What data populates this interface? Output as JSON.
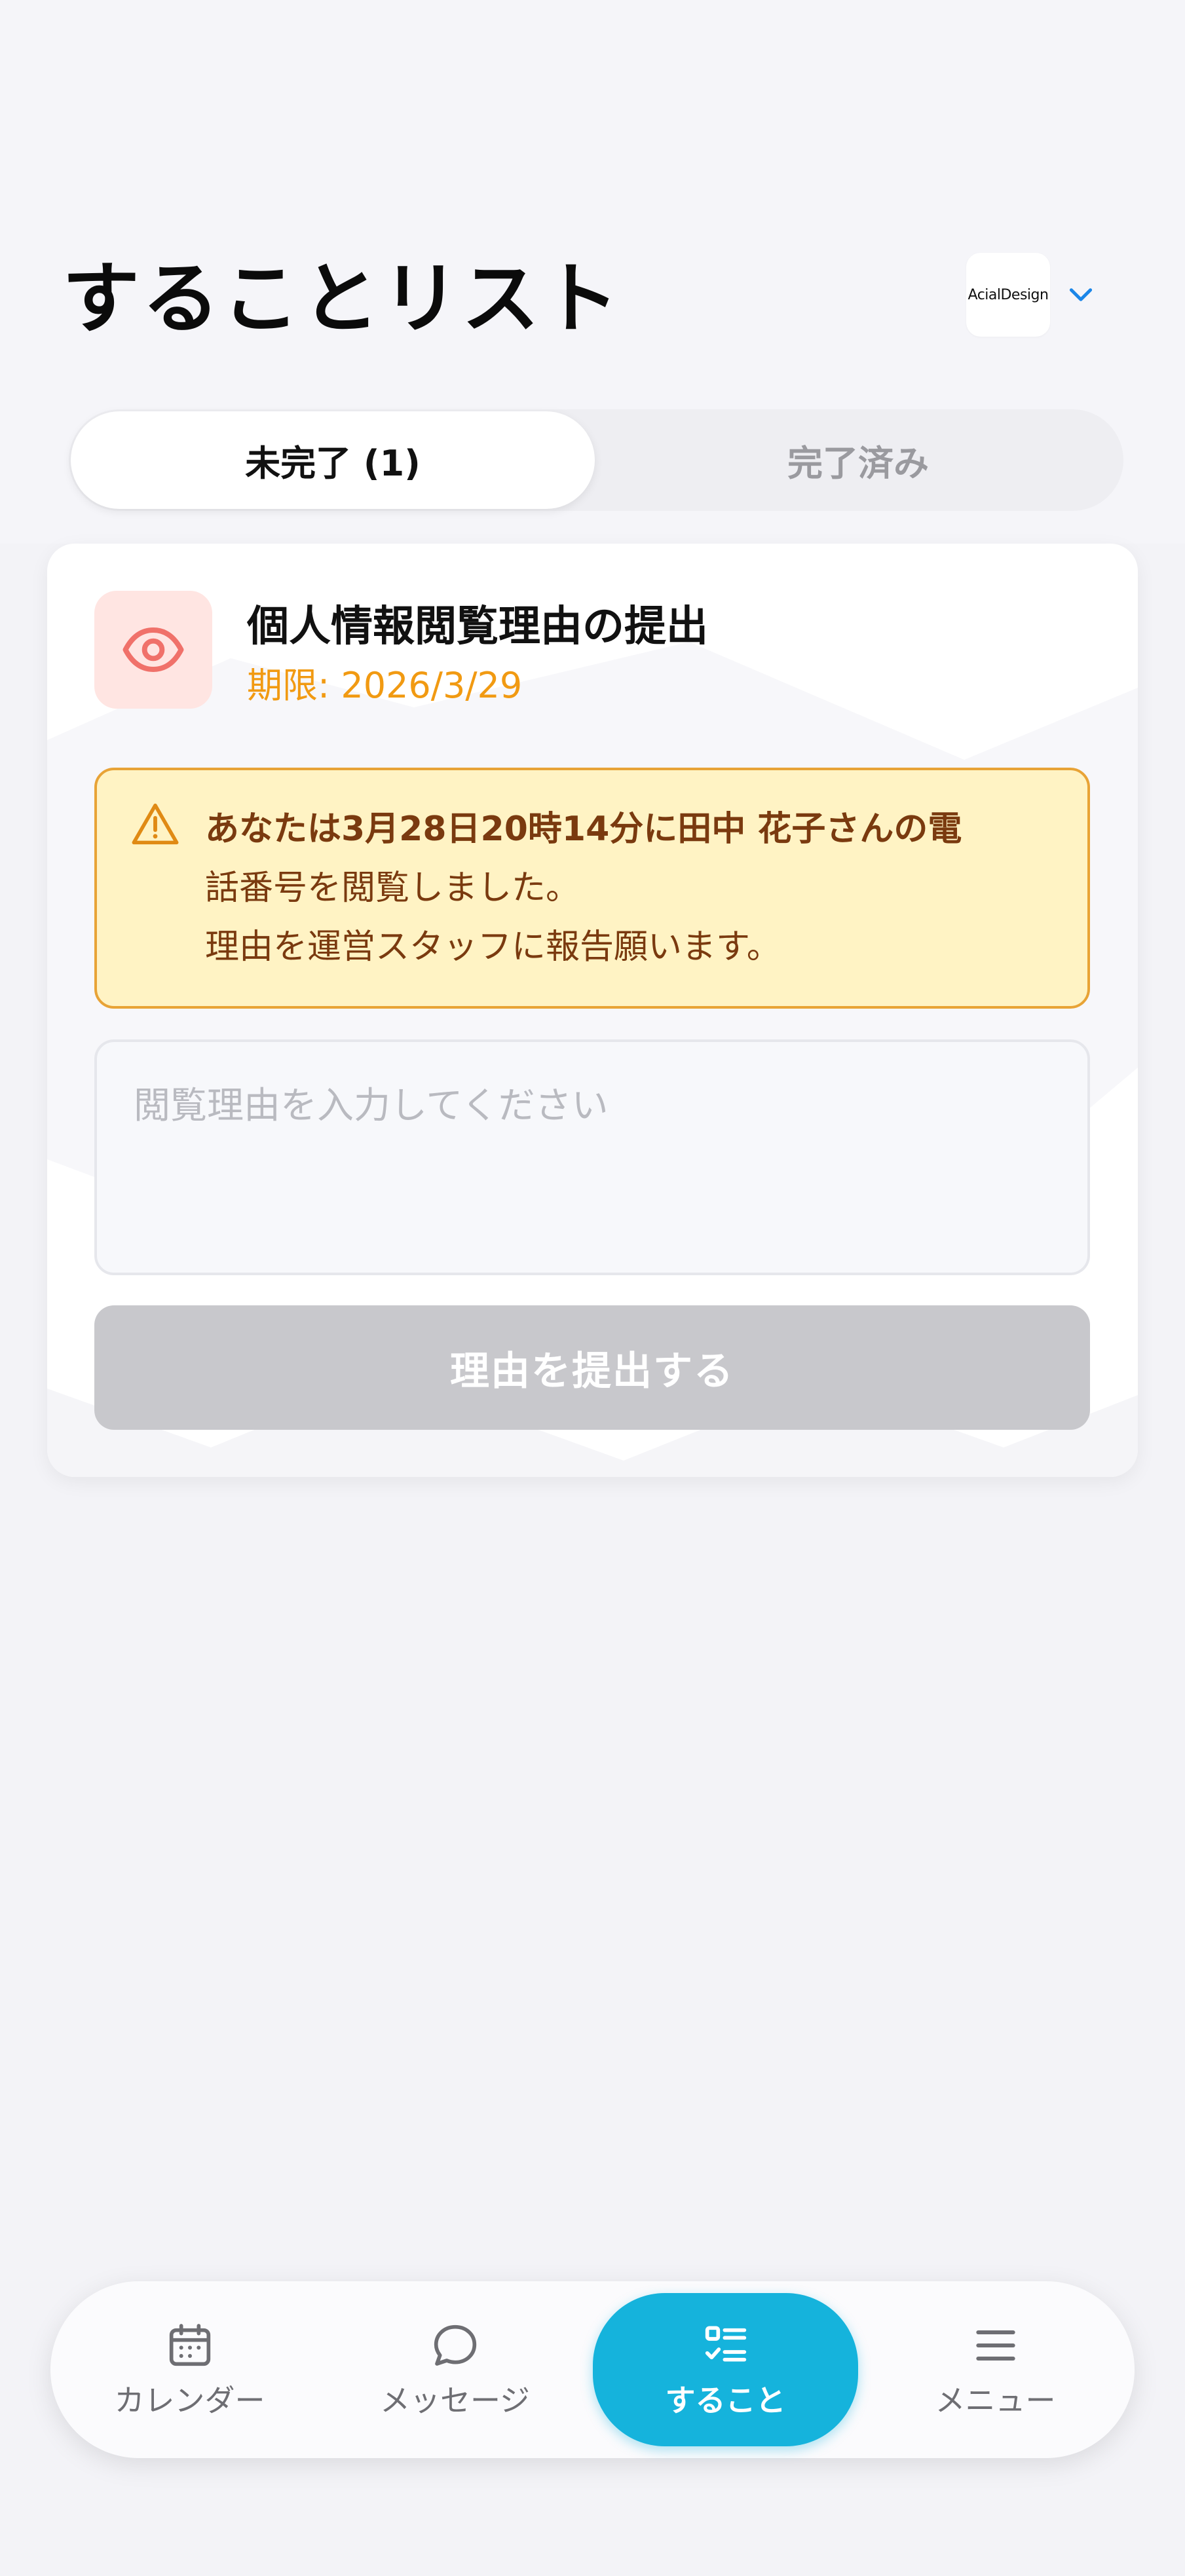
{
  "header": {
    "title": "することリスト",
    "org_logo_text": "AcialDesign"
  },
  "tabs": [
    {
      "label": "未完了 (1)",
      "active": true
    },
    {
      "label": "完了済み",
      "active": false
    }
  ],
  "task": {
    "icon": "eye-icon",
    "title": "個人情報閲覧理由の提出",
    "deadline": "期限: 2026/3/29",
    "alert": {
      "icon": "warning-icon",
      "line1": "あなたは3月28日20時14分に田中 花子さんの電",
      "line2": "話番号を閲覧しました。",
      "line3": "理由を運営スタッフに報告願います。"
    },
    "input": {
      "value": "",
      "placeholder": "閲覧理由を入力してください"
    },
    "submit_label": "理由を提出する"
  },
  "nav": [
    {
      "label": "カレンダー",
      "icon": "calendar-icon",
      "active": false
    },
    {
      "label": "メッセージ",
      "icon": "chat-bubble-icon",
      "active": false
    },
    {
      "label": "すること",
      "icon": "checklist-icon",
      "active": true
    },
    {
      "label": "メニュー",
      "icon": "menu-icon",
      "active": false
    }
  ],
  "colors": {
    "accent": "#15b3dc",
    "warning_bg": "#fff3c4",
    "warning_border": "#e8a336",
    "warning_text": "#7a3a0f",
    "deadline": "#f19a12",
    "icon_bg": "#ffe5e2",
    "icon_red": "#f0716a",
    "disabled_button": "#c8c8cc"
  }
}
